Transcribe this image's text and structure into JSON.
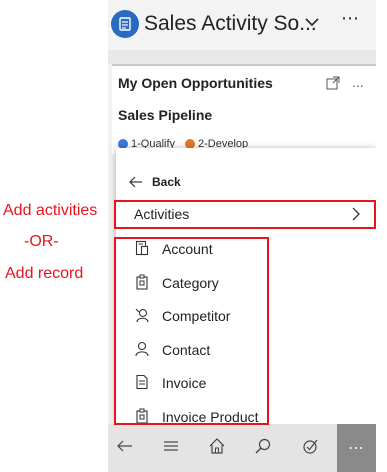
{
  "annotations": {
    "add_activities": "Add activities",
    "or": "-OR-",
    "add_record": "Add record",
    "color": "#e8141d"
  },
  "header": {
    "title": "Sales Activity So...",
    "more": "⋯",
    "logo_color": "#2a6bc1"
  },
  "card": {
    "title": "My Open Opportunities",
    "more": "...",
    "subtitle": "Sales Pipeline",
    "legend": [
      {
        "label": "1-Qualify",
        "color": "#3a7bd5"
      },
      {
        "label": "2-Develop",
        "color": "#e87722"
      }
    ]
  },
  "menu": {
    "back_label": "Back",
    "activities_label": "Activities",
    "records": [
      {
        "label": "Account",
        "icon": "account-icon"
      },
      {
        "label": "Category",
        "icon": "category-icon"
      },
      {
        "label": "Competitor",
        "icon": "competitor-icon"
      },
      {
        "label": "Contact",
        "icon": "contact-icon"
      },
      {
        "label": "Invoice",
        "icon": "invoice-icon"
      },
      {
        "label": "Invoice Product",
        "icon": "invoice-product-icon"
      }
    ]
  },
  "bottom_nav": {
    "items": [
      "back-icon",
      "menu-icon",
      "home-icon",
      "search-icon",
      "activity-icon"
    ],
    "more": "⋯"
  }
}
